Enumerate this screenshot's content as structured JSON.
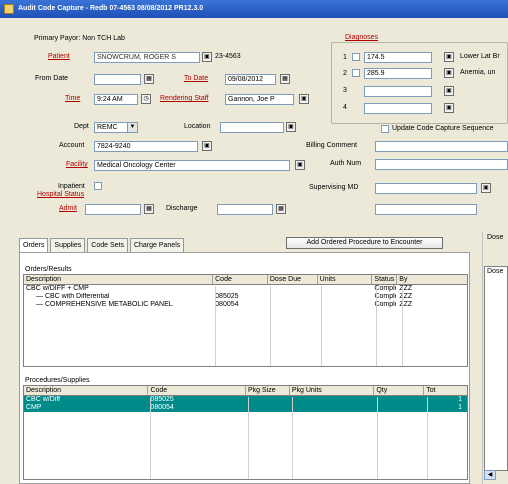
{
  "window": {
    "title": "Audit Code Capture - Redb 07-4563 08/08/2012 PR12.3.0"
  },
  "form": {
    "primary_payor_label": "Primary Payor: Non TCH Lab",
    "patient_label": "Patient",
    "patient_value": "SNOWCRUM, ROGER S",
    "patient_id": "23-4563",
    "from_date_label": "From Date",
    "to_date_label": "To Date",
    "to_date_value": "09/08/2012",
    "time_label": "Time",
    "time_value": "9:24 AM",
    "rendering_staff_label": "Rendering Staff",
    "rendering_staff_value": "Gannon, Joe P",
    "dept_label": "Dept",
    "dept_value": "REMC",
    "location_label": "Location",
    "account_label": "Account",
    "account_value": "7824-9240",
    "facility_label": "Facility",
    "facility_value": "Medical Oncology Center",
    "inpatient_label": "Inpatient",
    "hospital_status_label": "Hospital Status",
    "admit_label": "Admit",
    "discharge_label": "Discharge",
    "billing_comment_label": "Billing Comment",
    "auth_num_label": "Auth Num",
    "supervising_md_label": "Supervising MD",
    "dx_label": "Diagnoses",
    "dx": [
      {
        "num": "1",
        "code": "174.5",
        "desc": "Lower Lat Br"
      },
      {
        "num": "2",
        "code": "285.9",
        "desc": "Anemia, un"
      },
      {
        "num": "3",
        "code": "",
        "desc": ""
      },
      {
        "num": "4",
        "code": "",
        "desc": ""
      }
    ],
    "update_code_capture_label": "Update Code Capture Sequence"
  },
  "tabs": [
    "Orders",
    "Supplies",
    "Code Sets",
    "Charge Panels"
  ],
  "add_button_label": "Add Ordered Procedure to Encounter",
  "orders_section_label": "Orders/Results",
  "orders_table": {
    "headers": [
      "Description",
      "Code",
      "Dose Due",
      "Units",
      "Status",
      "By"
    ],
    "rows": [
      [
        "CBC w/DIFF + CMP",
        "",
        "",
        "",
        "Complete",
        "ZZZ"
      ],
      [
        "— CBC with Differential",
        "085025",
        "",
        "",
        "Complete",
        "ZZZ"
      ],
      [
        "— COMPREHENSIVE METABOLIC PANEL",
        "080054",
        "",
        "",
        "Complete",
        "ZZZ"
      ]
    ]
  },
  "supplies_section_label": "Procedures/Supplies",
  "supplies_table": {
    "headers": [
      "Description",
      "Code",
      "Pkg Size",
      "Pkg Units",
      "Qty",
      "Tot"
    ],
    "rows": [
      [
        "CBC w/Diff",
        "085025",
        "",
        "",
        "",
        "1"
      ],
      [
        "CMP",
        "080054",
        "",
        "",
        "",
        "1"
      ]
    ]
  },
  "right_pane": {
    "label": "Dose",
    "header": "Dose"
  },
  "colors": {
    "titlebar": "#1e4fb8",
    "link": "#b00000",
    "selected_row": "#008b8b"
  }
}
